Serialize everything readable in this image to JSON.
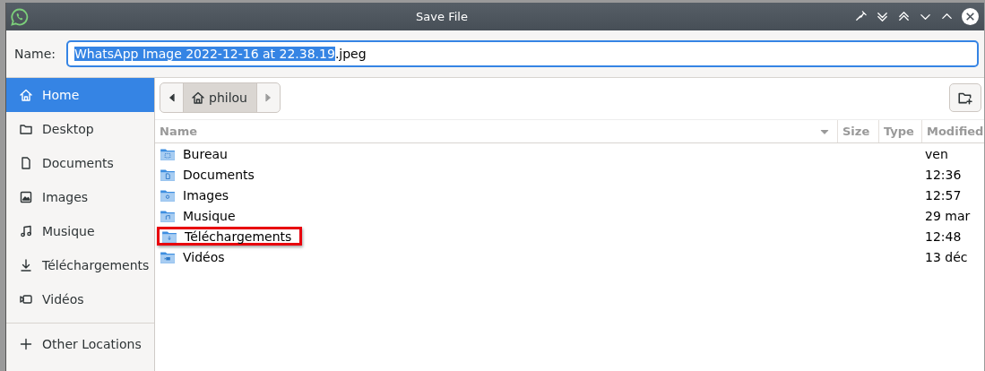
{
  "window": {
    "title": "Save File"
  },
  "name_field": {
    "label": "Name:",
    "selected_text": "WhatsApp Image 2022-12-16 at 22.38.19",
    "rest_text": ".jpeg"
  },
  "sidebar": {
    "items": [
      {
        "label": "Home",
        "kind": "home",
        "selected": true
      },
      {
        "label": "Desktop",
        "kind": "folder",
        "selected": false
      },
      {
        "label": "Documents",
        "kind": "document",
        "selected": false
      },
      {
        "label": "Images",
        "kind": "image",
        "selected": false
      },
      {
        "label": "Musique",
        "kind": "music",
        "selected": false
      },
      {
        "label": "Téléchargements",
        "kind": "download",
        "selected": false
      },
      {
        "label": "Vidéos",
        "kind": "video",
        "selected": false
      }
    ],
    "other": {
      "label": "Other Locations"
    }
  },
  "path_bar": {
    "segments": [
      {
        "label": "philou",
        "kind": "home",
        "selected": true
      }
    ]
  },
  "table": {
    "columns": [
      "Name",
      "Size",
      "Type",
      "Modified"
    ],
    "rows": [
      {
        "name": "Bureau",
        "kind": "desktop",
        "modified": "ven",
        "annotated": false
      },
      {
        "name": "Documents",
        "kind": "document",
        "modified": "12:36",
        "annotated": false
      },
      {
        "name": "Images",
        "kind": "image",
        "modified": "12:57",
        "annotated": false
      },
      {
        "name": "Musique",
        "kind": "music",
        "modified": "29 mar",
        "annotated": false
      },
      {
        "name": "Téléchargements",
        "kind": "download",
        "modified": "12:48",
        "annotated": true
      },
      {
        "name": "Vidéos",
        "kind": "video",
        "modified": "13 déc",
        "annotated": false
      }
    ]
  }
}
